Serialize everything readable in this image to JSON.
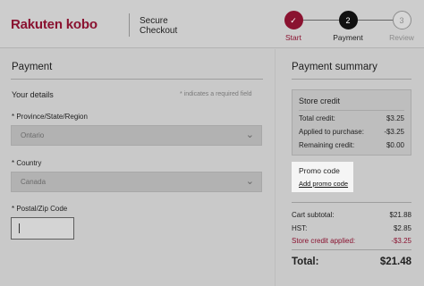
{
  "header": {
    "logo": "Rakuten kobo",
    "secure_line1": "Secure",
    "secure_line2": "Checkout",
    "steps": [
      {
        "number": "✓",
        "label": "Start",
        "status": "complete"
      },
      {
        "number": "2",
        "label": "Payment",
        "status": "current"
      },
      {
        "number": "3",
        "label": "Review",
        "status": "upcoming"
      }
    ]
  },
  "payment": {
    "title": "Payment",
    "your_details": "Your details",
    "required_note": "* indicates a required field",
    "province_label": "* Province/State/Region",
    "province_value": "Ontario",
    "country_label": "* Country",
    "country_value": "Canada",
    "postal_label": "* Postal/Zip Code",
    "postal_value": ""
  },
  "summary": {
    "title": "Payment summary",
    "store_credit_title": "Store credit",
    "total_credit_label": "Total credit:",
    "total_credit_value": "$3.25",
    "applied_label": "Applied to purchase:",
    "applied_value": "-$3.25",
    "remaining_label": "Remaining credit:",
    "remaining_value": "$0.00",
    "promo_title": "Promo code",
    "promo_link": "Add promo code",
    "cart_subtotal_label": "Cart subtotal:",
    "cart_subtotal_value": "$21.88",
    "hst_label": "HST:",
    "hst_value": "$2.85",
    "store_credit_applied_label": "Store credit applied:",
    "store_credit_applied_value": "-$3.25",
    "total_label": "Total:",
    "total_value": "$21.48"
  },
  "colors": {
    "brand": "#8a1230",
    "step_complete": "#8a1230",
    "step_current": "#111111"
  }
}
